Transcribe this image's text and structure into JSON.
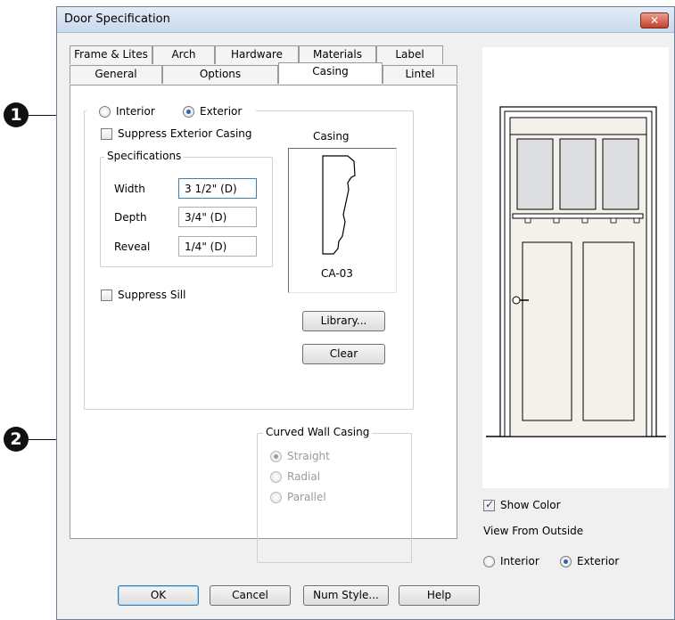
{
  "callouts": {
    "one": "1",
    "two": "2"
  },
  "window": {
    "title": "Door Specification",
    "close_glyph": "✕"
  },
  "tabs": {
    "row1": [
      "Frame & Lites",
      "Arch",
      "Hardware",
      "Materials",
      "Label"
    ],
    "row2": [
      "General",
      "Options",
      "Casing",
      "Lintel"
    ],
    "active": "Casing"
  },
  "casing_side": {
    "interior_label": "Interior",
    "exterior_label": "Exterior",
    "selected": "Exterior"
  },
  "suppress_exterior_casing": {
    "label": "Suppress Exterior Casing",
    "checked": false
  },
  "specifications": {
    "legend": "Specifications",
    "width_label": "Width",
    "width_value": "3 1/2\" (D)",
    "depth_label": "Depth",
    "depth_value": "3/4\" (D)",
    "reveal_label": "Reveal",
    "reveal_value": "1/4\" (D)"
  },
  "casing_preview": {
    "title": "Casing",
    "profile_name": "CA-03"
  },
  "suppress_sill": {
    "label": "Suppress Sill",
    "checked": false
  },
  "buttons": {
    "library": "Library...",
    "clear": "Clear",
    "ok": "OK",
    "cancel": "Cancel",
    "num_style": "Num Style...",
    "help": "Help"
  },
  "curved_wall_casing": {
    "legend": "Curved Wall Casing",
    "options": [
      "Straight",
      "Radial",
      "Parallel"
    ],
    "selected": "Straight",
    "disabled": true
  },
  "door_preview": {
    "show_color_label": "Show Color",
    "show_color_checked": true,
    "view_from_label": "View From Outside",
    "interior_label": "Interior",
    "exterior_label": "Exterior",
    "selected": "Exterior"
  },
  "colors": {
    "door_fill": "#f3f1ea",
    "glass_fill": "#dcdedf",
    "accent": "#2a63b8"
  }
}
